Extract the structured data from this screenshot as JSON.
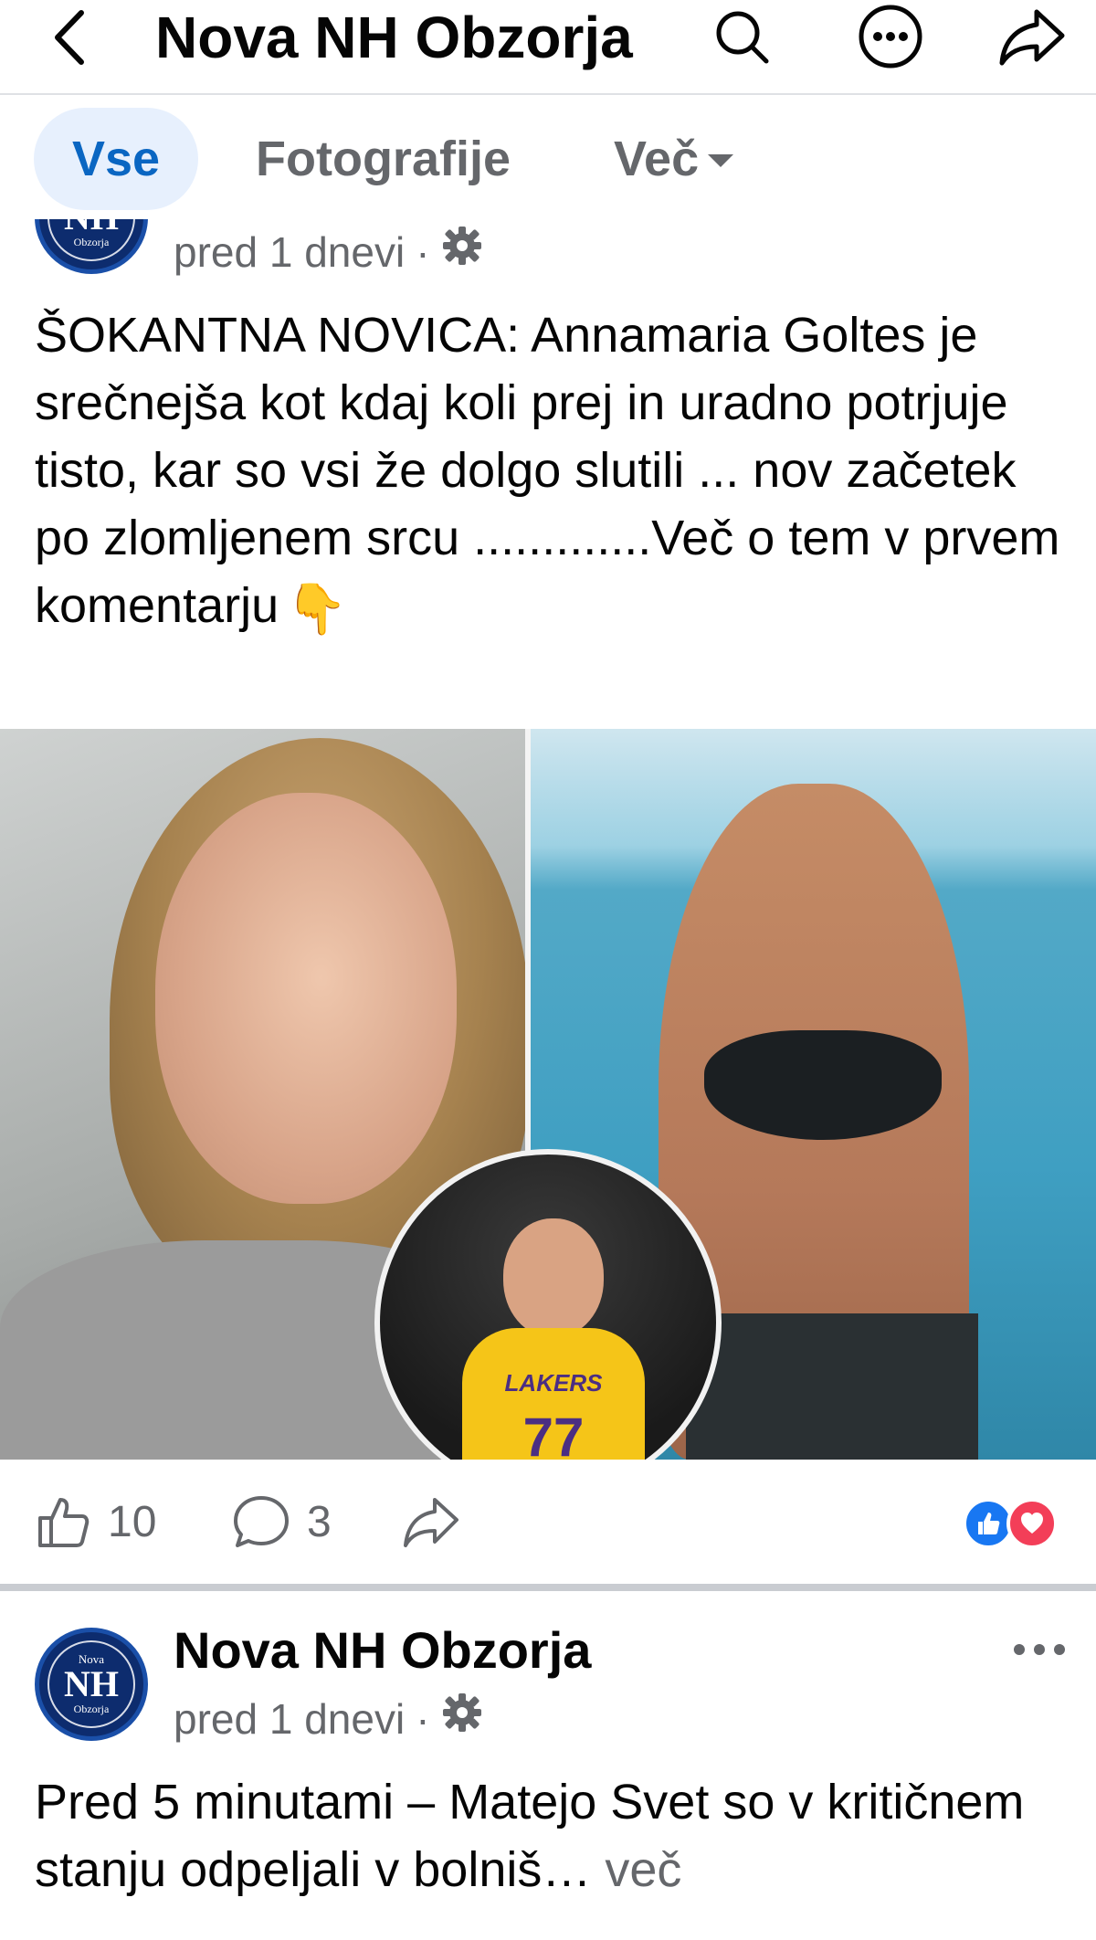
{
  "header": {
    "title": "Nova NH Obzorja",
    "icons": [
      "back-arrow-icon",
      "search-icon",
      "more-options-icon",
      "share-icon"
    ]
  },
  "tabs": {
    "all": "Vse",
    "photos": "Fotografije",
    "more": "Več"
  },
  "avatar": {
    "top_text": "Nova",
    "main_text": "NH",
    "bottom_text": "Obzorja"
  },
  "post1": {
    "time": "pred 1 dnevi",
    "separator": "·",
    "privacy_icon": "gear-icon",
    "text": "ŠOKANTNA NOVICA: Annamaria Goltes je srečnejša kot kdaj koli prej in uradno potrjuje tisto, kar so vsi že dolgo slutili ... nov začetek po zlomljenem srcu .............Več o tem v prvem komentarju",
    "emoji": "👇",
    "photo": {
      "jersey_team": "LAKERS",
      "jersey_number": "77"
    },
    "likes": "10",
    "comments": "3",
    "reactions": [
      "like",
      "love"
    ]
  },
  "post2": {
    "page_name": "Nova NH Obzorja",
    "time": "pred 1 dnevi",
    "separator": "·",
    "text": "Pred 5 minutami – Matejo Svet so v kritičnem stanju odpeljali v bolniš…",
    "see_more": "več"
  },
  "colors": {
    "accent": "#0a66c2",
    "tab_active_bg": "#e7f0fd",
    "secondary_text": "#65676b",
    "like_blue": "#1877f2",
    "love_red": "#f33e58"
  }
}
